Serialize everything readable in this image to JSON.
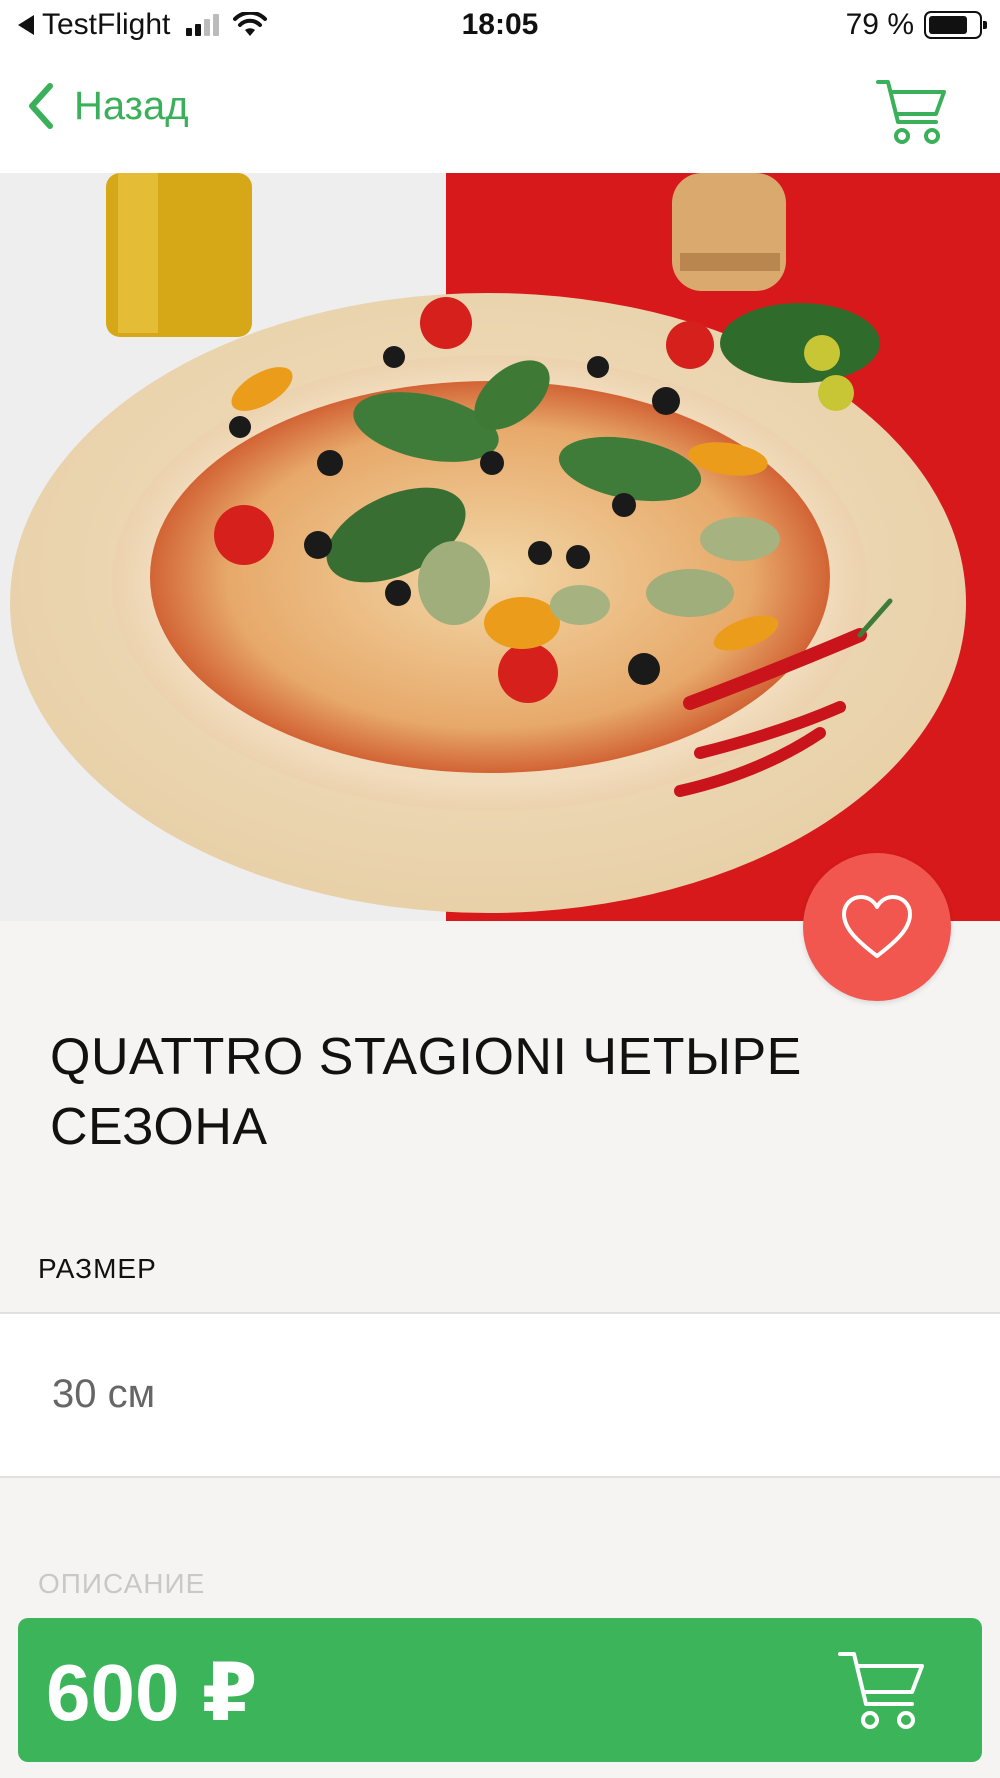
{
  "status_bar": {
    "app_name": "TestFlight",
    "time": "18:05",
    "battery": "79 %",
    "battery_level": 0.79
  },
  "nav": {
    "back_label": "Назад",
    "cart_icon": "cart-icon",
    "accent_color": "#3bb05a"
  },
  "product": {
    "title": "QUATTRO STAGIONI ЧЕТЫРЕ СЕЗОНА",
    "favorite_icon": "heart-icon",
    "favorite_color": "#f2574f"
  },
  "size_section": {
    "label": "РАЗМЕР",
    "selected": "30 см"
  },
  "description_section": {
    "label": "ОПИСАНИЕ"
  },
  "buy_bar": {
    "price": "600 ₽",
    "cart_icon": "cart-icon",
    "color": "#3cb55a"
  }
}
